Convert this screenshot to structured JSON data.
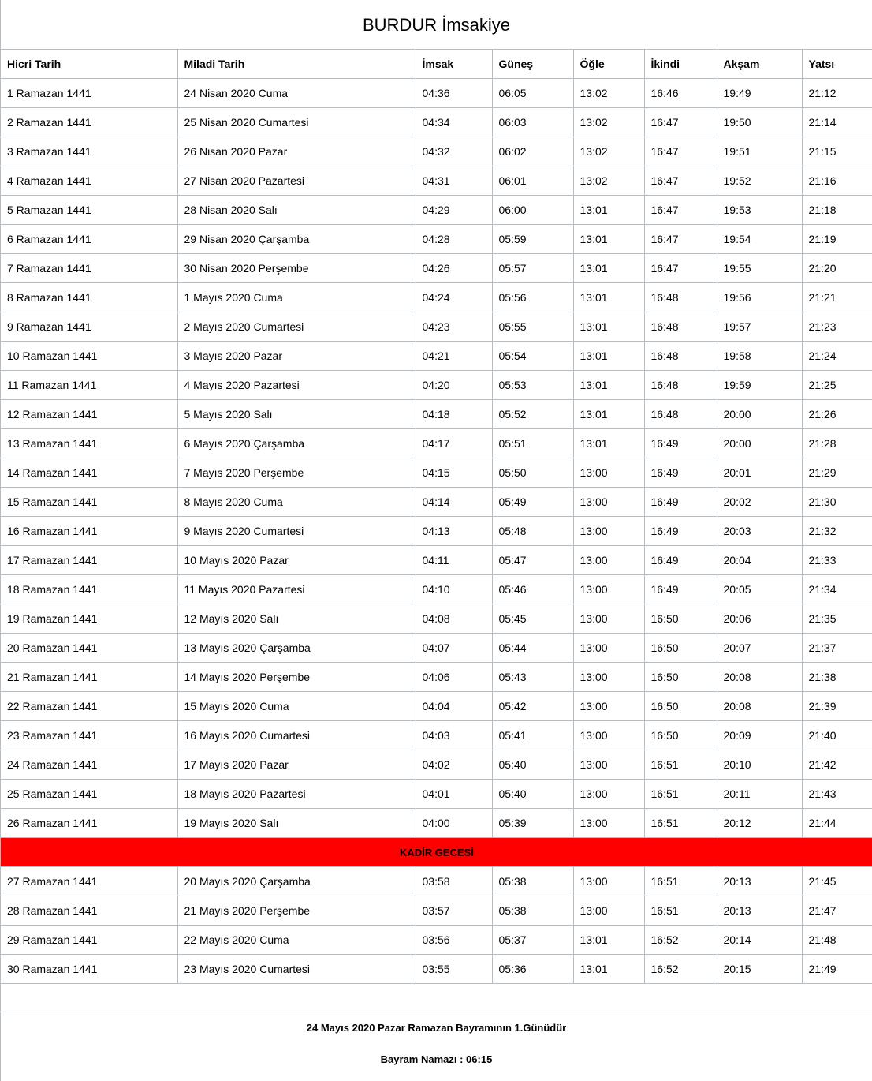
{
  "title": "BURDUR İmsakiye",
  "columns": [
    "Hicri Tarih",
    "Miladi Tarih",
    "İmsak",
    "Güneş",
    "Öğle",
    "İkindi",
    "Akşam",
    "Yatsı"
  ],
  "rows_a": [
    [
      "1 Ramazan 1441",
      "24 Nisan 2020 Cuma",
      "04:36",
      "06:05",
      "13:02",
      "16:46",
      "19:49",
      "21:12"
    ],
    [
      "2 Ramazan 1441",
      "25 Nisan 2020 Cumartesi",
      "04:34",
      "06:03",
      "13:02",
      "16:47",
      "19:50",
      "21:14"
    ],
    [
      "3 Ramazan 1441",
      "26 Nisan 2020 Pazar",
      "04:32",
      "06:02",
      "13:02",
      "16:47",
      "19:51",
      "21:15"
    ],
    [
      "4 Ramazan 1441",
      "27 Nisan 2020 Pazartesi",
      "04:31",
      "06:01",
      "13:02",
      "16:47",
      "19:52",
      "21:16"
    ],
    [
      "5 Ramazan 1441",
      "28 Nisan 2020 Salı",
      "04:29",
      "06:00",
      "13:01",
      "16:47",
      "19:53",
      "21:18"
    ],
    [
      "6 Ramazan 1441",
      "29 Nisan 2020 Çarşamba",
      "04:28",
      "05:59",
      "13:01",
      "16:47",
      "19:54",
      "21:19"
    ],
    [
      "7 Ramazan 1441",
      "30 Nisan 2020 Perşembe",
      "04:26",
      "05:57",
      "13:01",
      "16:47",
      "19:55",
      "21:20"
    ],
    [
      "8 Ramazan 1441",
      "1 Mayıs 2020 Cuma",
      "04:24",
      "05:56",
      "13:01",
      "16:48",
      "19:56",
      "21:21"
    ],
    [
      "9 Ramazan 1441",
      "2 Mayıs 2020 Cumartesi",
      "04:23",
      "05:55",
      "13:01",
      "16:48",
      "19:57",
      "21:23"
    ],
    [
      "10 Ramazan 1441",
      "3 Mayıs 2020 Pazar",
      "04:21",
      "05:54",
      "13:01",
      "16:48",
      "19:58",
      "21:24"
    ],
    [
      "11 Ramazan 1441",
      "4 Mayıs 2020 Pazartesi",
      "04:20",
      "05:53",
      "13:01",
      "16:48",
      "19:59",
      "21:25"
    ],
    [
      "12 Ramazan 1441",
      "5 Mayıs 2020 Salı",
      "04:18",
      "05:52",
      "13:01",
      "16:48",
      "20:00",
      "21:26"
    ],
    [
      "13 Ramazan 1441",
      "6 Mayıs 2020 Çarşamba",
      "04:17",
      "05:51",
      "13:01",
      "16:49",
      "20:00",
      "21:28"
    ],
    [
      "14 Ramazan 1441",
      "7 Mayıs 2020 Perşembe",
      "04:15",
      "05:50",
      "13:00",
      "16:49",
      "20:01",
      "21:29"
    ],
    [
      "15 Ramazan 1441",
      "8 Mayıs 2020 Cuma",
      "04:14",
      "05:49",
      "13:00",
      "16:49",
      "20:02",
      "21:30"
    ],
    [
      "16 Ramazan 1441",
      "9 Mayıs 2020 Cumartesi",
      "04:13",
      "05:48",
      "13:00",
      "16:49",
      "20:03",
      "21:32"
    ],
    [
      "17 Ramazan 1441",
      "10 Mayıs 2020 Pazar",
      "04:11",
      "05:47",
      "13:00",
      "16:49",
      "20:04",
      "21:33"
    ],
    [
      "18 Ramazan 1441",
      "11 Mayıs 2020 Pazartesi",
      "04:10",
      "05:46",
      "13:00",
      "16:49",
      "20:05",
      "21:34"
    ],
    [
      "19 Ramazan 1441",
      "12 Mayıs 2020 Salı",
      "04:08",
      "05:45",
      "13:00",
      "16:50",
      "20:06",
      "21:35"
    ],
    [
      "20 Ramazan 1441",
      "13 Mayıs 2020 Çarşamba",
      "04:07",
      "05:44",
      "13:00",
      "16:50",
      "20:07",
      "21:37"
    ],
    [
      "21 Ramazan 1441",
      "14 Mayıs 2020 Perşembe",
      "04:06",
      "05:43",
      "13:00",
      "16:50",
      "20:08",
      "21:38"
    ],
    [
      "22 Ramazan 1441",
      "15 Mayıs 2020 Cuma",
      "04:04",
      "05:42",
      "13:00",
      "16:50",
      "20:08",
      "21:39"
    ],
    [
      "23 Ramazan 1441",
      "16 Mayıs 2020 Cumartesi",
      "04:03",
      "05:41",
      "13:00",
      "16:50",
      "20:09",
      "21:40"
    ],
    [
      "24 Ramazan 1441",
      "17 Mayıs 2020 Pazar",
      "04:02",
      "05:40",
      "13:00",
      "16:51",
      "20:10",
      "21:42"
    ],
    [
      "25 Ramazan 1441",
      "18 Mayıs 2020 Pazartesi",
      "04:01",
      "05:40",
      "13:00",
      "16:51",
      "20:11",
      "21:43"
    ],
    [
      "26 Ramazan 1441",
      "19 Mayıs 2020 Salı",
      "04:00",
      "05:39",
      "13:00",
      "16:51",
      "20:12",
      "21:44"
    ]
  ],
  "special_row": {
    "label": "KADİR GECESİ",
    "color": "#ff0000"
  },
  "rows_b": [
    [
      "27 Ramazan 1441",
      "20 Mayıs 2020 Çarşamba",
      "03:58",
      "05:38",
      "13:00",
      "16:51",
      "20:13",
      "21:45"
    ],
    [
      "28 Ramazan 1441",
      "21 Mayıs 2020 Perşembe",
      "03:57",
      "05:38",
      "13:00",
      "16:51",
      "20:13",
      "21:47"
    ],
    [
      "29 Ramazan 1441",
      "22 Mayıs 2020 Cuma",
      "03:56",
      "05:37",
      "13:01",
      "16:52",
      "20:14",
      "21:48"
    ],
    [
      "30 Ramazan 1441",
      "23 Mayıs 2020 Cumartesi",
      "03:55",
      "05:36",
      "13:01",
      "16:52",
      "20:15",
      "21:49"
    ]
  ],
  "footer": {
    "bayram_text": "24 Mayıs 2020 Pazar Ramazan Bayramının 1.Günüdür",
    "namaz_text": "Bayram Namazı : 06:15"
  }
}
